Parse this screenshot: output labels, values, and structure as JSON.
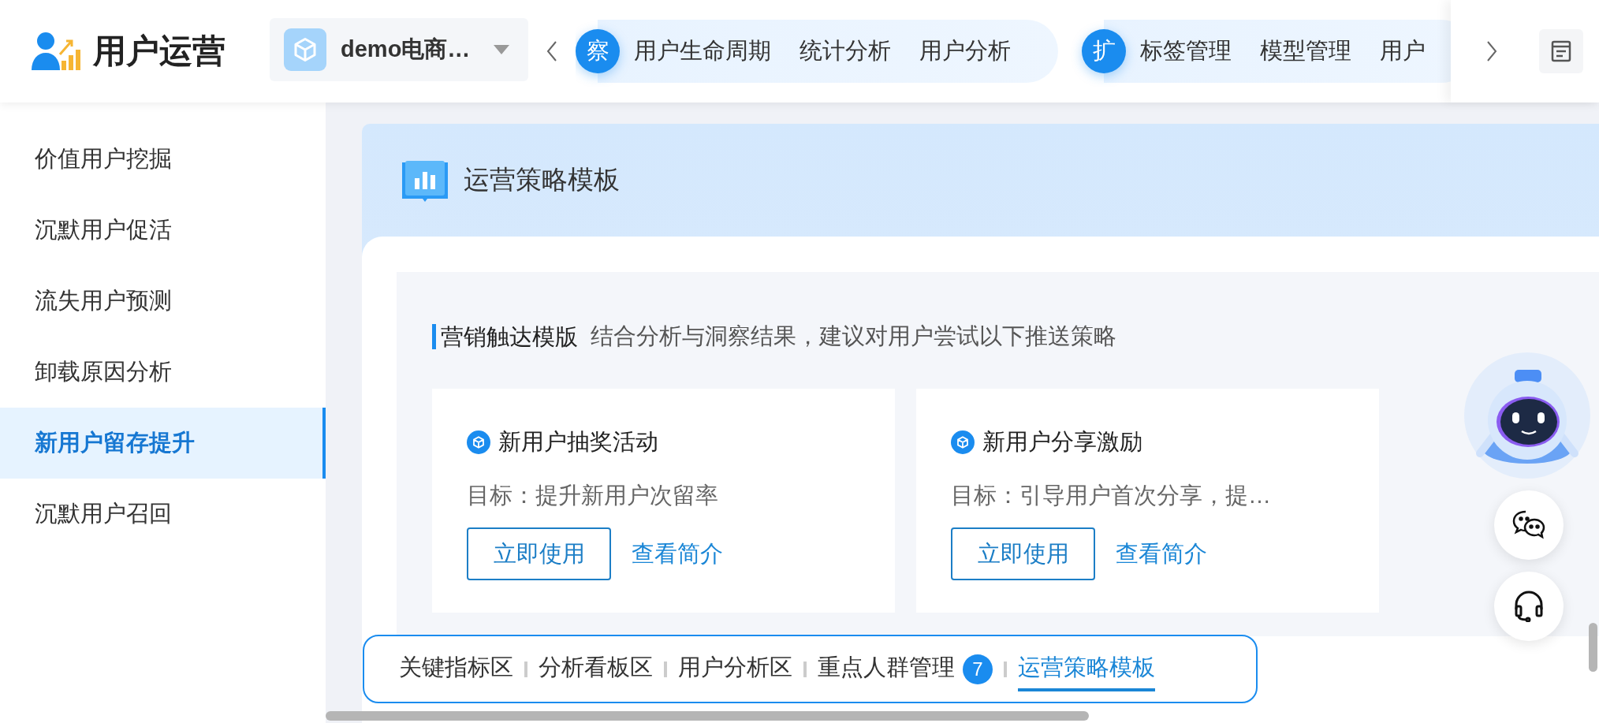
{
  "app": {
    "title": "用户运营"
  },
  "project_select": {
    "value": "demo电商…"
  },
  "nav_groups": [
    {
      "badge": "察",
      "items": [
        "用户生命周期",
        "统计分析",
        "用户分析"
      ]
    },
    {
      "badge": "扩",
      "items": [
        "标签管理",
        "模型管理",
        "用户"
      ]
    }
  ],
  "sidebar": {
    "items": [
      {
        "label": "价值用户挖掘",
        "selected": false
      },
      {
        "label": "沉默用户促活",
        "selected": false
      },
      {
        "label": "流失用户预测",
        "selected": false
      },
      {
        "label": "卸载原因分析",
        "selected": false
      },
      {
        "label": "新用户留存提升",
        "selected": true
      },
      {
        "label": "沉默用户召回",
        "selected": false
      }
    ]
  },
  "section": {
    "title": "运营策略模板",
    "subsection": {
      "title": "营销触达模版",
      "description": "结合分析与洞察结果，建议对用户尝试以下推送策略"
    },
    "cards": [
      {
        "title": "新用户抽奖活动",
        "goal": "目标：提升新用户次留率",
        "action": "立即使用",
        "link": "查看简介"
      },
      {
        "title": "新用户分享激励",
        "goal": "目标：引导用户首次分享，提…",
        "action": "立即使用",
        "link": "查看简介"
      }
    ]
  },
  "anchor_tabs": [
    {
      "label": "关键指标区",
      "selected": false
    },
    {
      "label": "分析看板区",
      "selected": false
    },
    {
      "label": "用户分析区",
      "selected": false
    },
    {
      "label": "重点人群管理",
      "selected": false,
      "count": "7"
    },
    {
      "label": "运营策略模板",
      "selected": true
    }
  ]
}
